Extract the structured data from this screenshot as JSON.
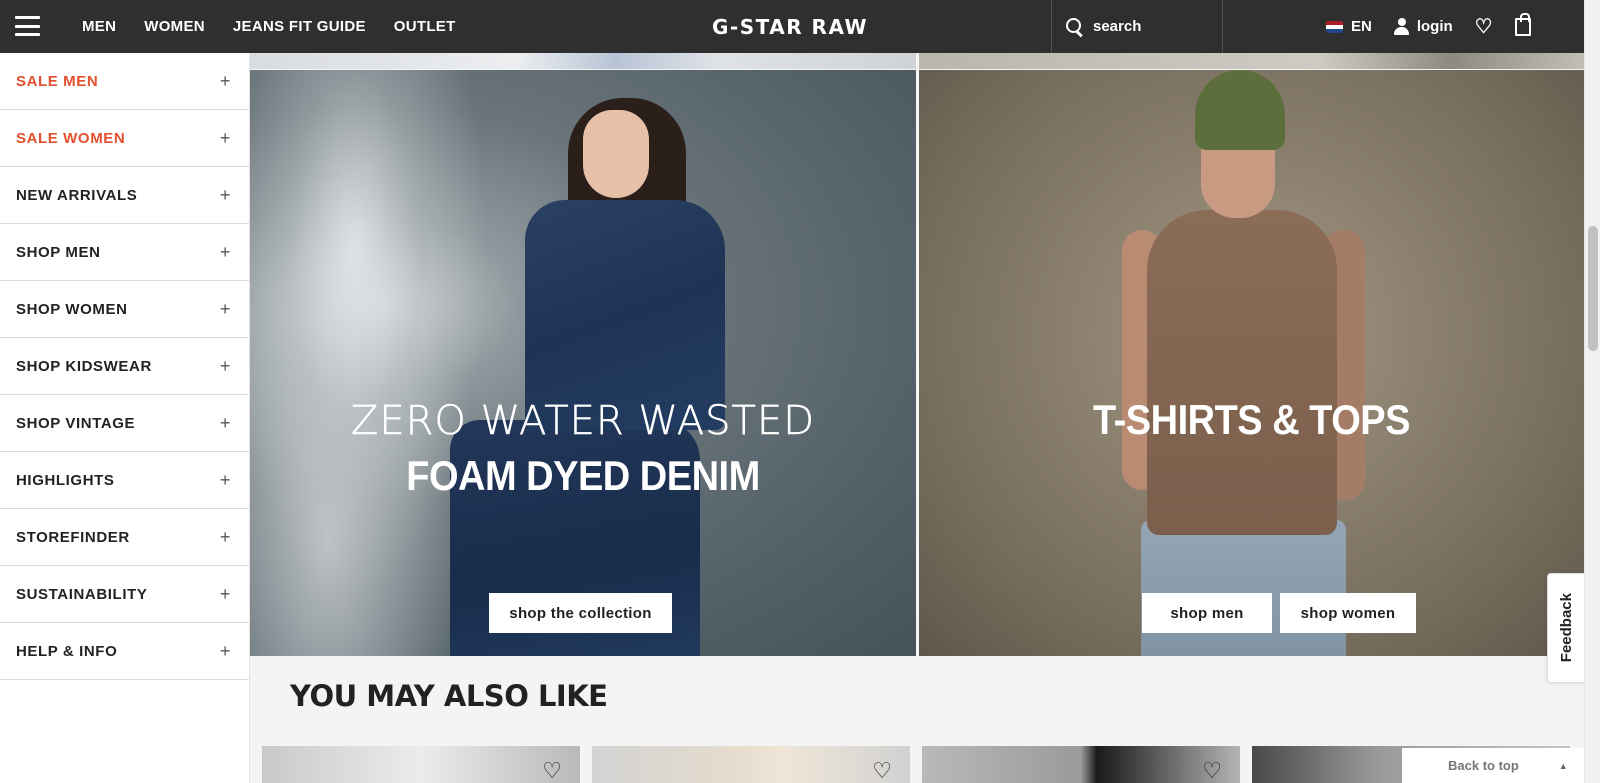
{
  "header": {
    "nav": [
      "MEN",
      "WOMEN",
      "JEANS FIT GUIDE",
      "OUTLET"
    ],
    "logo": "G-STAR RAW",
    "search_label": "search",
    "language": "EN",
    "login_label": "login"
  },
  "sidebar": {
    "items": [
      {
        "label": "SALE MEN"
      },
      {
        "label": "SALE WOMEN"
      },
      {
        "label": "NEW ARRIVALS"
      },
      {
        "label": "SHOP MEN"
      },
      {
        "label": "SHOP WOMEN"
      },
      {
        "label": "SHOP KIDSWEAR"
      },
      {
        "label": "SHOP VINTAGE"
      },
      {
        "label": "HIGHLIGHTS"
      },
      {
        "label": "STOREFINDER"
      },
      {
        "label": "SUSTAINABILITY"
      },
      {
        "label": "HELP & INFO"
      }
    ],
    "expand_glyph": "+"
  },
  "promos": {
    "left": {
      "headline_outline": "ZERO WATER WASTED",
      "headline": "FOAM DYED DENIM",
      "button": "shop the collection"
    },
    "right": {
      "headline": "T-SHIRTS & TOPS",
      "button_men": "shop men",
      "button_women": "shop women"
    }
  },
  "recommendations": {
    "title": "YOU MAY ALSO LIKE"
  },
  "feedback_label": "Feedback",
  "back_to_top": "Back to top",
  "colors": {
    "header_bg": "#2f2f2f",
    "sale_accent": "#e2502d",
    "flag": [
      "#ae1c28",
      "#ffffff",
      "#21468b"
    ]
  },
  "icons": [
    "menu-icon",
    "search-icon",
    "flag-nl-icon",
    "user-icon",
    "heart-icon",
    "bag-icon",
    "plus-icon",
    "caret-up-icon"
  ]
}
